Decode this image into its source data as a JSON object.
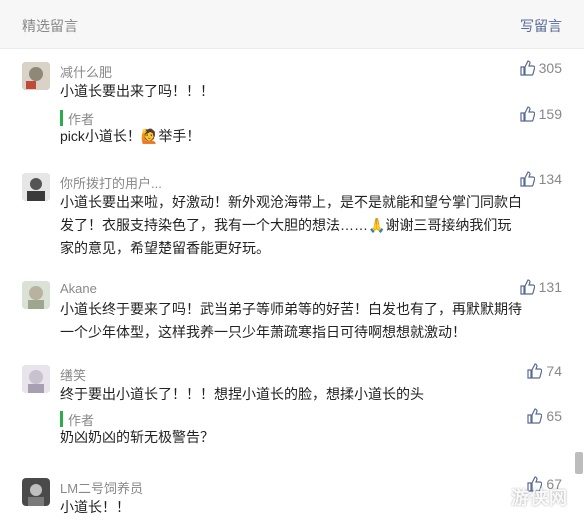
{
  "header": {
    "title": "精选留言",
    "write_label": "写留言"
  },
  "comments": [
    {
      "nickname": "减什么肥",
      "text_lines": [
        "小道长要出来了吗！！！"
      ],
      "likes": "305",
      "reply": {
        "label": "作者",
        "text": "pick小道长！🙋举手！",
        "likes": "159"
      }
    },
    {
      "nickname": "你所拨打的用户...",
      "text_lines": [
        "小道长要出来啦，好激动！新外观沧海带上，是不是就能和望兮掌门同款白",
        "发了！衣服支持染色了，我有一个大胆的想法……🙏谢谢三哥接纳我们玩",
        "家的意见，希望楚留香能更好玩。"
      ],
      "likes": "134"
    },
    {
      "nickname": "Akane",
      "text_lines": [
        "小道长终于要来了吗！武当弟子等师弟等的好苦！白发也有了，再默默期待",
        "一个少年体型，这样我养一只少年萧疏寒指日可待啊想想就激动！"
      ],
      "likes": "131"
    },
    {
      "nickname": "缮笑",
      "text_lines": [
        "终于要出小道长了！！！想捏小道长的脸，想揉小道长的头"
      ],
      "likes": "74",
      "reply": {
        "label": "作者",
        "text": "奶凶奶凶的斩无极警告？",
        "likes": "65"
      }
    },
    {
      "nickname": "LM二号饲养员",
      "text_lines": [
        "小道长！！"
      ],
      "likes": "67"
    }
  ],
  "watermark": "游侠网",
  "colors": {
    "link": "#576b95",
    "reply_bar": "#2bad4a",
    "muted": "#888888"
  },
  "icons": [
    "thumbs-up-icon",
    "avatar-image"
  ]
}
